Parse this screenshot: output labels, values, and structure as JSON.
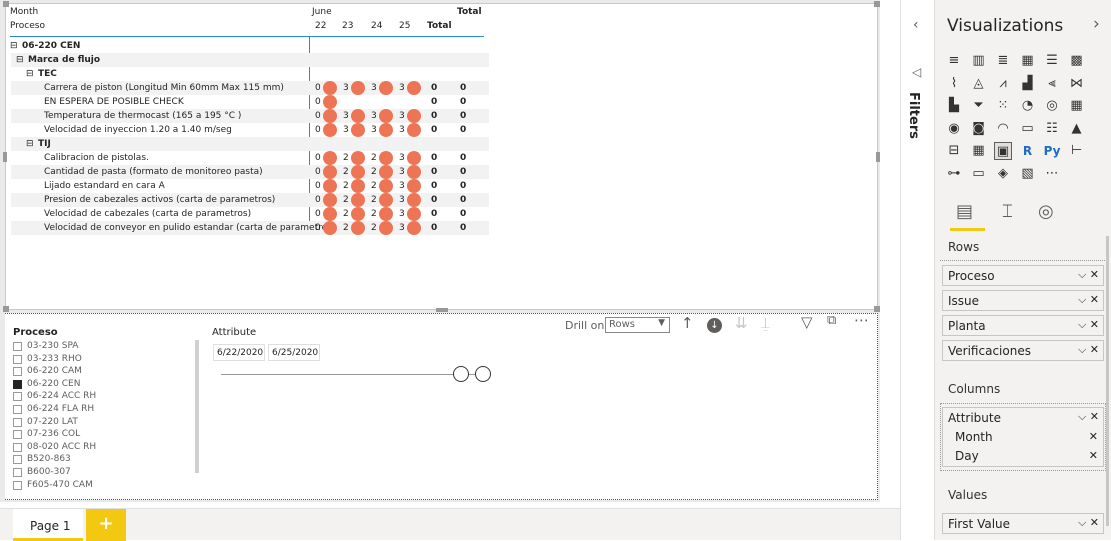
{
  "matrix": {
    "header": {
      "month_label": "Month",
      "proceso_label": "Proceso",
      "month_value": "June",
      "days": [
        "22",
        "23",
        "24",
        "25"
      ],
      "total": "Total"
    },
    "group": "06-220 CEN",
    "subgroup": "Marca de flujo",
    "sections": [
      {
        "name": "TEC",
        "rows": [
          {
            "label": "Carrera de piston (Longitud Min 60mm Max 115 mm)",
            "vals": [
              "0",
              "3",
              "3",
              "3"
            ],
            "total": "0",
            "total2": "0"
          },
          {
            "label": "EN ESPERA DE POSIBLE CHECK",
            "vals": [
              "0",
              "",
              "",
              ""
            ],
            "total": "0",
            "total2": "0"
          },
          {
            "label": "Temperatura de thermocast (165 a 195 °C )",
            "vals": [
              "0",
              "3",
              "3",
              "3"
            ],
            "total": "0",
            "total2": "0"
          },
          {
            "label": "Velocidad de inyeccion 1.20 a 1.40 m/seg",
            "vals": [
              "0",
              "3",
              "3",
              "3"
            ],
            "total": "0",
            "total2": "0"
          }
        ]
      },
      {
        "name": "TIJ",
        "rows": [
          {
            "label": "Calibracion de pistolas.",
            "vals": [
              "0",
              "2",
              "2",
              "3"
            ],
            "total": "0",
            "total2": "0"
          },
          {
            "label": "Cantidad de pasta (formato de monitoreo pasta)",
            "vals": [
              "0",
              "2",
              "2",
              "3"
            ],
            "total": "0",
            "total2": "0"
          },
          {
            "label": "Lijado estandard en cara A",
            "vals": [
              "0",
              "2",
              "2",
              "3"
            ],
            "total": "0",
            "total2": "0"
          },
          {
            "label": "Presion de cabezales activos (carta de parametros)",
            "vals": [
              "0",
              "2",
              "2",
              "3"
            ],
            "total": "0",
            "total2": "0"
          },
          {
            "label": "Velocidad de cabezales (carta de parametros)",
            "vals": [
              "0",
              "2",
              "2",
              "3"
            ],
            "total": "0",
            "total2": "0"
          },
          {
            "label": "Velocidad de conveyor en pulido estandar (carta de parametros)",
            "vals": [
              "0",
              "2",
              "2",
              "3"
            ],
            "total": "0",
            "total2": "0"
          }
        ]
      }
    ]
  },
  "toolbar": {
    "drill_on": "Drill on",
    "drill_value": "Rows"
  },
  "slicer": {
    "title": "Proceso",
    "items": [
      {
        "label": "03-230 SPA",
        "checked": false
      },
      {
        "label": "03-233 RHO",
        "checked": false
      },
      {
        "label": "06-220 CAM",
        "checked": false
      },
      {
        "label": "06-220 CEN",
        "checked": true
      },
      {
        "label": "06-224 ACC RH",
        "checked": false
      },
      {
        "label": "06-224 FLA RH",
        "checked": false
      },
      {
        "label": "07-220 LAT",
        "checked": false
      },
      {
        "label": "07-236 COL",
        "checked": false
      },
      {
        "label": "08-020 ACC RH",
        "checked": false
      },
      {
        "label": "B520-863",
        "checked": false
      },
      {
        "label": "B600-307",
        "checked": false
      },
      {
        "label": "F605-470 CAM",
        "checked": false
      }
    ]
  },
  "date_slicer": {
    "title": "Attribute",
    "start": "6/22/2020",
    "end": "6/25/2020"
  },
  "footer": {
    "page": "Page 1",
    "add": "+"
  },
  "filters": {
    "label": "Filters"
  },
  "viz": {
    "title": "Visualizations",
    "rows_label": "Rows",
    "rows": [
      "Proceso",
      "Issue",
      "Planta",
      "Verificaciones"
    ],
    "columns_label": "Columns",
    "columns_field": "Attribute",
    "columns_sub": [
      "Month",
      "Day"
    ],
    "values_label": "Values",
    "values": [
      "First Value"
    ],
    "icons": [
      "stacked-bar",
      "stacked-column",
      "clustered-bar",
      "clustered-column",
      "100-bar",
      "100-column",
      "line",
      "area",
      "stacked-area",
      "line-column",
      "line-clustered",
      "ribbon",
      "waterfall",
      "funnel",
      "scatter",
      "pie",
      "donut",
      "treemap",
      "map",
      "filled-map",
      "gauge",
      "card",
      "multi-card",
      "kpi",
      "slicer",
      "table",
      "matrix",
      "r-visual",
      "py-visual",
      "key-influencers",
      "decomposition",
      "qa",
      "smart-narrative",
      "paginated",
      "more"
    ],
    "accent": "#f2c811"
  }
}
